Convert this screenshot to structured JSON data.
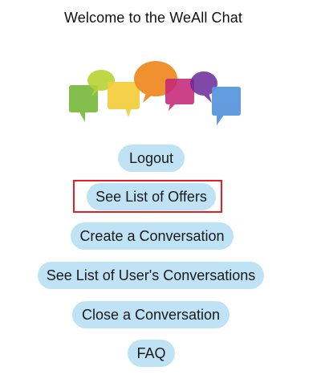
{
  "header": {
    "title": "Welcome to the WeAll Chat"
  },
  "logo": {
    "icon": "speech-bubbles-logo-icon",
    "colors": [
      "#7dbb42",
      "#b7d334",
      "#f3cd3a",
      "#ef8c24",
      "#c52878",
      "#8e2e9c",
      "#4a2a8a",
      "#5b97dd"
    ]
  },
  "menu": {
    "logout": "Logout",
    "see_offers": "See List of Offers",
    "create_conversation": "Create a Conversation",
    "list_conversations": "See List of User's Conversations",
    "close_conversation": "Close a Conversation",
    "faq": "FAQ"
  },
  "highlight": {
    "target": "see_offers",
    "color": "#e41f26"
  },
  "colors": {
    "button_bg": "#bfe2f4"
  }
}
